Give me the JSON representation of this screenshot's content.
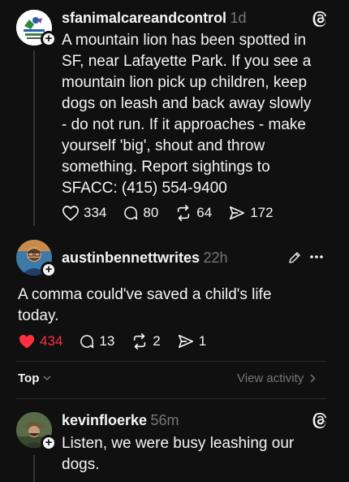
{
  "post1": {
    "username": "sfanimalcareandcontrol",
    "time": "1d",
    "avatar_text": "SF ANIMAL CARE & CONTROL",
    "lines": [
      "A mountain lion has been spotted in",
      "SF, near Lafayette Park. If you see a",
      "mountain lion pick up children, keep",
      "dogs on leash and back away slowly",
      "- do not run. If it approaches - make",
      "yourself 'big', shout and throw",
      "something. Report sightings to",
      "SFACC: (415) 554-9400"
    ],
    "likes": "334",
    "replies": "80",
    "reposts": "64",
    "shares": "172"
  },
  "post2": {
    "username": "austinbennettwrites",
    "time": "22h",
    "lines": [
      "A comma could've saved a child's life",
      "today."
    ],
    "likes": "434",
    "replies": "13",
    "reposts": "2",
    "shares": "1",
    "sort_label": "Top",
    "view_activity": "View activity"
  },
  "post3": {
    "username": "kevinfloerke",
    "time": "56m",
    "lines": [
      "Listen, we were busy leashing our",
      "dogs."
    ]
  },
  "colors": {
    "background": "#101010",
    "text": "#f3f5f7",
    "muted": "#777777",
    "like_red": "#ff3040"
  },
  "icons": [
    "threads-logo-icon",
    "heart-icon",
    "reply-icon",
    "repost-icon",
    "share-icon",
    "edit-icon",
    "more-icon",
    "chevron-down-icon",
    "chevron-right-icon",
    "plus-icon"
  ]
}
